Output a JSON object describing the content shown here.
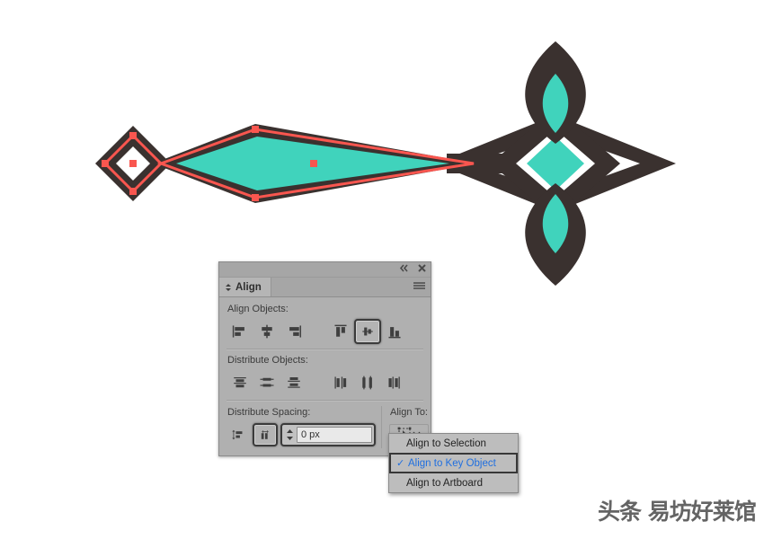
{
  "panel": {
    "title_tab": "Align",
    "titlebar_icons": [
      {
        "name": "collapse-icon",
        "glyph": "◀◀"
      },
      {
        "name": "close-icon",
        "glyph": "✕"
      }
    ],
    "menu_icon": "panel-menu-icon",
    "sections": {
      "align_objects": {
        "label": "Align Objects:",
        "buttons": [
          {
            "name": "align-left-button",
            "tip": "Horizontal Align Left",
            "active": false
          },
          {
            "name": "align-horizontal-center-button",
            "tip": "Horizontal Align Center",
            "active": false
          },
          {
            "name": "align-right-button",
            "tip": "Horizontal Align Right",
            "active": false
          },
          {
            "name": "align-top-button",
            "tip": "Vertical Align Top",
            "active": false
          },
          {
            "name": "align-vertical-center-button",
            "tip": "Vertical Align Center",
            "active": true
          },
          {
            "name": "align-bottom-button",
            "tip": "Vertical Align Bottom",
            "active": false
          }
        ]
      },
      "distribute_objects": {
        "label": "Distribute Objects:",
        "buttons": [
          {
            "name": "distribute-vertical-top-button",
            "tip": "Vertical Distribute Top",
            "active": false
          },
          {
            "name": "distribute-vertical-center-button",
            "tip": "Vertical Distribute Center",
            "active": false
          },
          {
            "name": "distribute-vertical-bottom-button",
            "tip": "Vertical Distribute Bottom",
            "active": false
          },
          {
            "name": "distribute-horizontal-left-button",
            "tip": "Horizontal Distribute Left",
            "active": false
          },
          {
            "name": "distribute-horizontal-center-button",
            "tip": "Horizontal Distribute Center",
            "active": false
          },
          {
            "name": "distribute-horizontal-right-button",
            "tip": "Horizontal Distribute Right",
            "active": false
          }
        ]
      },
      "distribute_spacing": {
        "label": "Distribute Spacing:",
        "buttons": [
          {
            "name": "distribute-vertical-space-button",
            "active": false
          },
          {
            "name": "distribute-horizontal-space-button",
            "active": true
          }
        ],
        "value": "0 px",
        "placeholder": "0 px"
      },
      "align_to": {
        "label": "Align To:",
        "button_icon": "align-to-key-object-icon",
        "chevron": "⌄"
      }
    }
  },
  "dropdown": {
    "items": [
      {
        "label": "Align to Selection",
        "selected": false,
        "check": ""
      },
      {
        "label": "Align to Key Object",
        "selected": true,
        "check": "✓"
      },
      {
        "label": "Align to Artboard",
        "selected": false,
        "check": ""
      }
    ]
  },
  "watermark": {
    "text": "头条 易坊好莱馆"
  },
  "colors": {
    "artwork_dark": "#3a312f",
    "artwork_teal": "#40d3bc",
    "selection_red": "#f9564f",
    "panel_bg": "#b0b0b0",
    "panel_header": "#a6a6a6",
    "highlight_blue": "#1f6fe0"
  }
}
